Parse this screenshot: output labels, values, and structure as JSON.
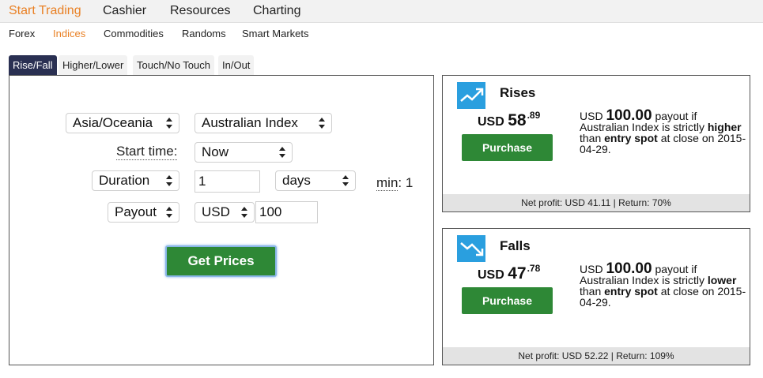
{
  "topnav": {
    "items": [
      "Start Trading",
      "Cashier",
      "Resources",
      "Charting"
    ],
    "active": "Start Trading"
  },
  "subnav": {
    "items": [
      "Forex",
      "Indices",
      "Commodities",
      "Randoms",
      "Smart Markets"
    ],
    "active": "Indices"
  },
  "tabs": {
    "items": [
      "Rise/Fall",
      "Higher/Lower",
      "Touch/No Touch",
      "In/Out"
    ],
    "active": "Rise/Fall"
  },
  "form": {
    "market": "Asia/Oceania",
    "underlying": "Australian Index",
    "start_time_label": "Start time:",
    "start_time": "Now",
    "duration_type": "Duration",
    "duration_value": "1",
    "duration_unit": "days",
    "min_label": "min",
    "min_value": ": 1",
    "amount_type": "Payout",
    "currency": "USD",
    "amount": "100",
    "get_prices": "Get Prices"
  },
  "rises": {
    "title": "Rises",
    "currency": "USD",
    "price_whole": "58",
    "price_cents": ".89",
    "purchase": "Purchase",
    "desc_currency": "USD",
    "desc_amount": "100.00",
    "desc_1": "payout if Australian Index is strictly",
    "desc_direction": "higher",
    "desc_2": "than",
    "desc_spot": "entry spot",
    "desc_3": "at close on 2015-04-29.",
    "footer": "Net profit: USD 41.11 | Return: 70%"
  },
  "falls": {
    "title": "Falls",
    "currency": "USD",
    "price_whole": "47",
    "price_cents": ".78",
    "purchase": "Purchase",
    "desc_currency": "USD",
    "desc_amount": "100.00",
    "desc_1": "payout if Australian Index is strictly",
    "desc_direction": "lower",
    "desc_2": "than",
    "desc_spot": "entry spot",
    "desc_3": "at close on 2015-04-29.",
    "footer": "Net profit: USD 52.22 | Return: 109%"
  },
  "colors": {
    "accent": "#e98024",
    "tab_active": "#2a3052",
    "button_green": "#2e8836",
    "icon_blue": "#2a9fdf"
  }
}
